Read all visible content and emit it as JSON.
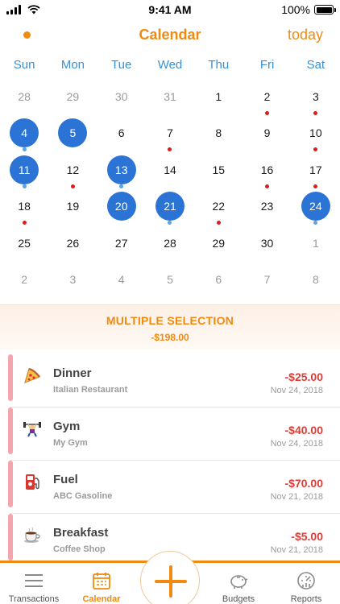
{
  "status": {
    "time": "9:41 AM",
    "battery": "100%",
    "battery_level": 1.0
  },
  "nav": {
    "title": "Calendar",
    "today_label": "today"
  },
  "weekdays": [
    "Sun",
    "Mon",
    "Tue",
    "Wed",
    "Thu",
    "Fri",
    "Sat"
  ],
  "calendar_days": [
    {
      "n": "28",
      "muted": true
    },
    {
      "n": "29",
      "muted": true
    },
    {
      "n": "30",
      "muted": true
    },
    {
      "n": "31",
      "muted": true
    },
    {
      "n": "1"
    },
    {
      "n": "2",
      "dot": "red"
    },
    {
      "n": "3",
      "dot": "red"
    },
    {
      "n": "4",
      "sel": true,
      "dot": "blue"
    },
    {
      "n": "5",
      "sel": true
    },
    {
      "n": "6"
    },
    {
      "n": "7",
      "dot": "red"
    },
    {
      "n": "8"
    },
    {
      "n": "9"
    },
    {
      "n": "10",
      "dot": "red"
    },
    {
      "n": "11",
      "sel": true,
      "dot": "blue"
    },
    {
      "n": "12",
      "dot": "red"
    },
    {
      "n": "13",
      "sel": true,
      "dot": "blue"
    },
    {
      "n": "14"
    },
    {
      "n": "15"
    },
    {
      "n": "16",
      "dot": "red"
    },
    {
      "n": "17",
      "dot": "red"
    },
    {
      "n": "18",
      "dot": "red"
    },
    {
      "n": "19"
    },
    {
      "n": "20",
      "sel": true
    },
    {
      "n": "21",
      "sel": true,
      "dot": "blue"
    },
    {
      "n": "22",
      "dot": "red"
    },
    {
      "n": "23"
    },
    {
      "n": "24",
      "sel": true,
      "dot": "blue"
    },
    {
      "n": "25"
    },
    {
      "n": "26"
    },
    {
      "n": "27"
    },
    {
      "n": "28"
    },
    {
      "n": "29"
    },
    {
      "n": "30"
    },
    {
      "n": "1",
      "muted": true
    },
    {
      "n": "2",
      "muted": true
    },
    {
      "n": "3",
      "muted": true
    },
    {
      "n": "4",
      "muted": true
    },
    {
      "n": "5",
      "muted": true
    },
    {
      "n": "6",
      "muted": true
    },
    {
      "n": "7",
      "muted": true
    },
    {
      "n": "8",
      "muted": true
    }
  ],
  "selection": {
    "title": "MULTIPLE SELECTION",
    "total": "-$198.00"
  },
  "transactions": [
    {
      "name": "Dinner",
      "place": "Italian Restaurant",
      "amount": "-$25.00",
      "date": "Nov 24, 2018",
      "icon": "pizza-icon"
    },
    {
      "name": "Gym",
      "place": "My Gym",
      "amount": "-$40.00",
      "date": "Nov 24, 2018",
      "icon": "weightlifter-icon"
    },
    {
      "name": "Fuel",
      "place": "ABC Gasoline",
      "amount": "-$70.00",
      "date": "Nov 21, 2018",
      "icon": "fuel-pump-icon"
    },
    {
      "name": "Breakfast",
      "place": "Coffee Shop",
      "amount": "-$5.00",
      "date": "Nov 21, 2018",
      "icon": "coffee-icon"
    }
  ],
  "tabs": [
    {
      "label": "Transactions",
      "icon": "list-icon",
      "active": false
    },
    {
      "label": "Calendar",
      "icon": "calendar-icon",
      "active": true
    },
    {
      "label": "Budgets",
      "icon": "piggy-bank-icon",
      "active": false
    },
    {
      "label": "Reports",
      "icon": "gauge-icon",
      "active": false
    }
  ],
  "colors": {
    "accent": "#f08a10",
    "selected": "#2b74d6",
    "expense": "#e03c36",
    "weekday": "#3a8fd2"
  }
}
